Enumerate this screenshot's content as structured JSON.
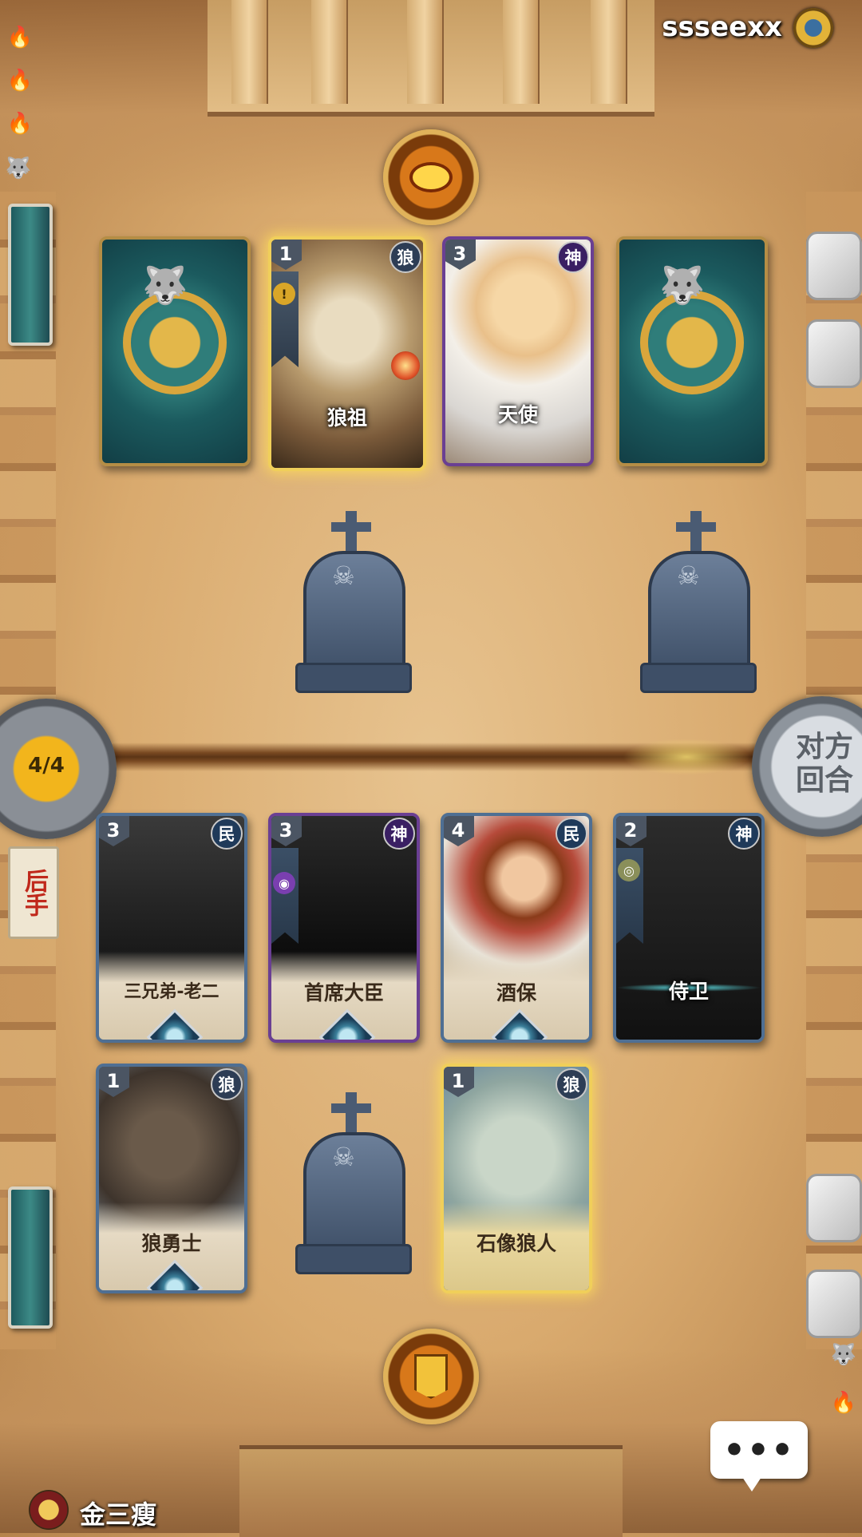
{
  "opponent": {
    "name": "ssseexx",
    "emblem_icon": "gear-emblem-icon"
  },
  "self": {
    "name": "金三瘦",
    "avatar_icon": "crown-avatar-icon"
  },
  "turn": {
    "counter": "4/4",
    "end_turn_label": "对方\n回合",
    "order_tag": "后手"
  },
  "chat": {
    "label": "•••"
  },
  "opponent_board": [
    {
      "type": "back"
    },
    {
      "type": "card",
      "name": "狼祖",
      "cost": "1",
      "faction": "狼",
      "style": "gold",
      "ribbon": "!",
      "art": "wolf-ancestor-art"
    },
    {
      "type": "card",
      "name": "天使",
      "cost": "3",
      "faction": "神",
      "style": "purple",
      "art": "angel-art"
    },
    {
      "type": "back"
    }
  ],
  "player_row1": [
    {
      "name": "三兄弟-老二",
      "cost": "3",
      "faction": "民",
      "style": "silver",
      "art": "silhouette"
    },
    {
      "name": "首席大臣",
      "cost": "3",
      "faction": "神",
      "style": "purple",
      "art": "silhouette",
      "ribbon": "◉"
    },
    {
      "name": "酒保",
      "cost": "4",
      "faction": "民",
      "style": "silver",
      "art": "bartender-art"
    },
    {
      "name": "侍卫",
      "cost": "2",
      "faction": "神",
      "style": "silver",
      "art": "guard-silhouette",
      "ribbon": "◎"
    }
  ],
  "player_row2": [
    {
      "name": "狼勇士",
      "cost": "1",
      "faction": "狼",
      "style": "silver",
      "art": "wolf-warrior-art"
    },
    {
      "name": "石像狼人",
      "cost": "1",
      "faction": "狼",
      "style": "gold",
      "art": "stone-werewolf-art"
    }
  ],
  "colors": {
    "gold_glow": "#f0cf5a",
    "wolf_faction": "#2d3d55",
    "god_faction": "#3a1f63",
    "people_faction": "#1f3a5a",
    "sand": "#d9aa6e"
  }
}
